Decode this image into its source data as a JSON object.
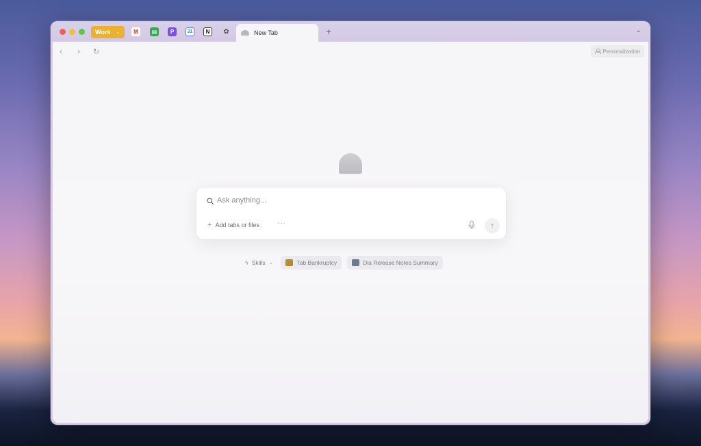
{
  "tabbar": {
    "space_label": "Work",
    "pinned_tabs": [
      {
        "icon": "gmail-icon",
        "glyph": "M"
      },
      {
        "icon": "sheets-icon",
        "glyph": "▤"
      },
      {
        "icon": "p-app-icon",
        "glyph": "P"
      },
      {
        "icon": "calendar-icon",
        "glyph": "31"
      },
      {
        "icon": "notion-icon",
        "glyph": "N"
      },
      {
        "icon": "chat-icon",
        "glyph": "✿"
      }
    ],
    "active_tab_title": "New Tab",
    "new_tab_glyph": "+",
    "tabs_menu_glyph": "⌄"
  },
  "toolbar": {
    "back_glyph": "‹",
    "forward_glyph": "›",
    "reload_glyph": "↻",
    "personalization_label": "Personalization"
  },
  "ask": {
    "placeholder": "Ask anything...",
    "add_label": "Add tabs or files",
    "more_glyph": "···",
    "send_glyph": "↑"
  },
  "suggestions": [
    {
      "label": "Skills"
    },
    {
      "label": "Tab Bankruptcy"
    },
    {
      "label": "Dia Release Notes Summary"
    }
  ],
  "colors": {
    "space_accent": "#eab133",
    "traffic_red": "#ee5f57",
    "traffic_yellow": "#f4bd39",
    "traffic_green": "#5fc54a"
  }
}
